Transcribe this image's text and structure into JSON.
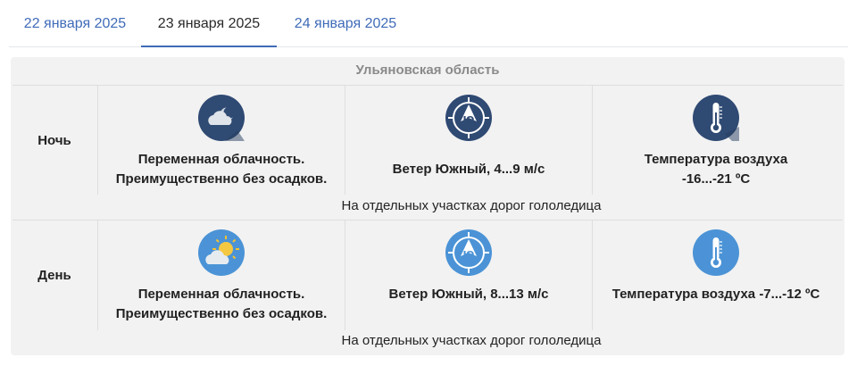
{
  "tabs": [
    {
      "label": "22 января 2025"
    },
    {
      "label": "23 января 2025"
    },
    {
      "label": "24 января 2025"
    }
  ],
  "active_tab": 1,
  "region": "Ульяновская область",
  "rows": [
    {
      "label": "Ночь",
      "sky": {
        "line1": "Переменная облачность.",
        "line2": "Преимущественно без осадков."
      },
      "wind": {
        "text": "Ветер Южный, 4...9 м/с"
      },
      "temp": {
        "line1": "Температура воздуха",
        "line2": "-16...-21 ºС"
      },
      "note": "На отдельных участках дорог гололедица"
    },
    {
      "label": "День",
      "sky": {
        "line1": "Переменная облачность.",
        "line2": "Преимущественно без осадков."
      },
      "wind": {
        "text": "Ветер Южный, 8...13 м/с"
      },
      "temp": {
        "line1": "Температура воздуха -7...-12 ºС",
        "line2": ""
      },
      "note": "На отдельных участках дорог гололедица"
    }
  ],
  "icons": {
    "night_sky": "cloud-moon-icon",
    "day_sky": "cloud-sun-icon",
    "wind": "compass-south-icon",
    "temp": "thermometer-icon",
    "wind_letter": "Ю"
  },
  "colors": {
    "accent": "#3f6bb8",
    "night_icon_bg": "#2f4a73",
    "day_icon_bg": "#4b93d6",
    "panel_bg": "#f2f2f2"
  }
}
